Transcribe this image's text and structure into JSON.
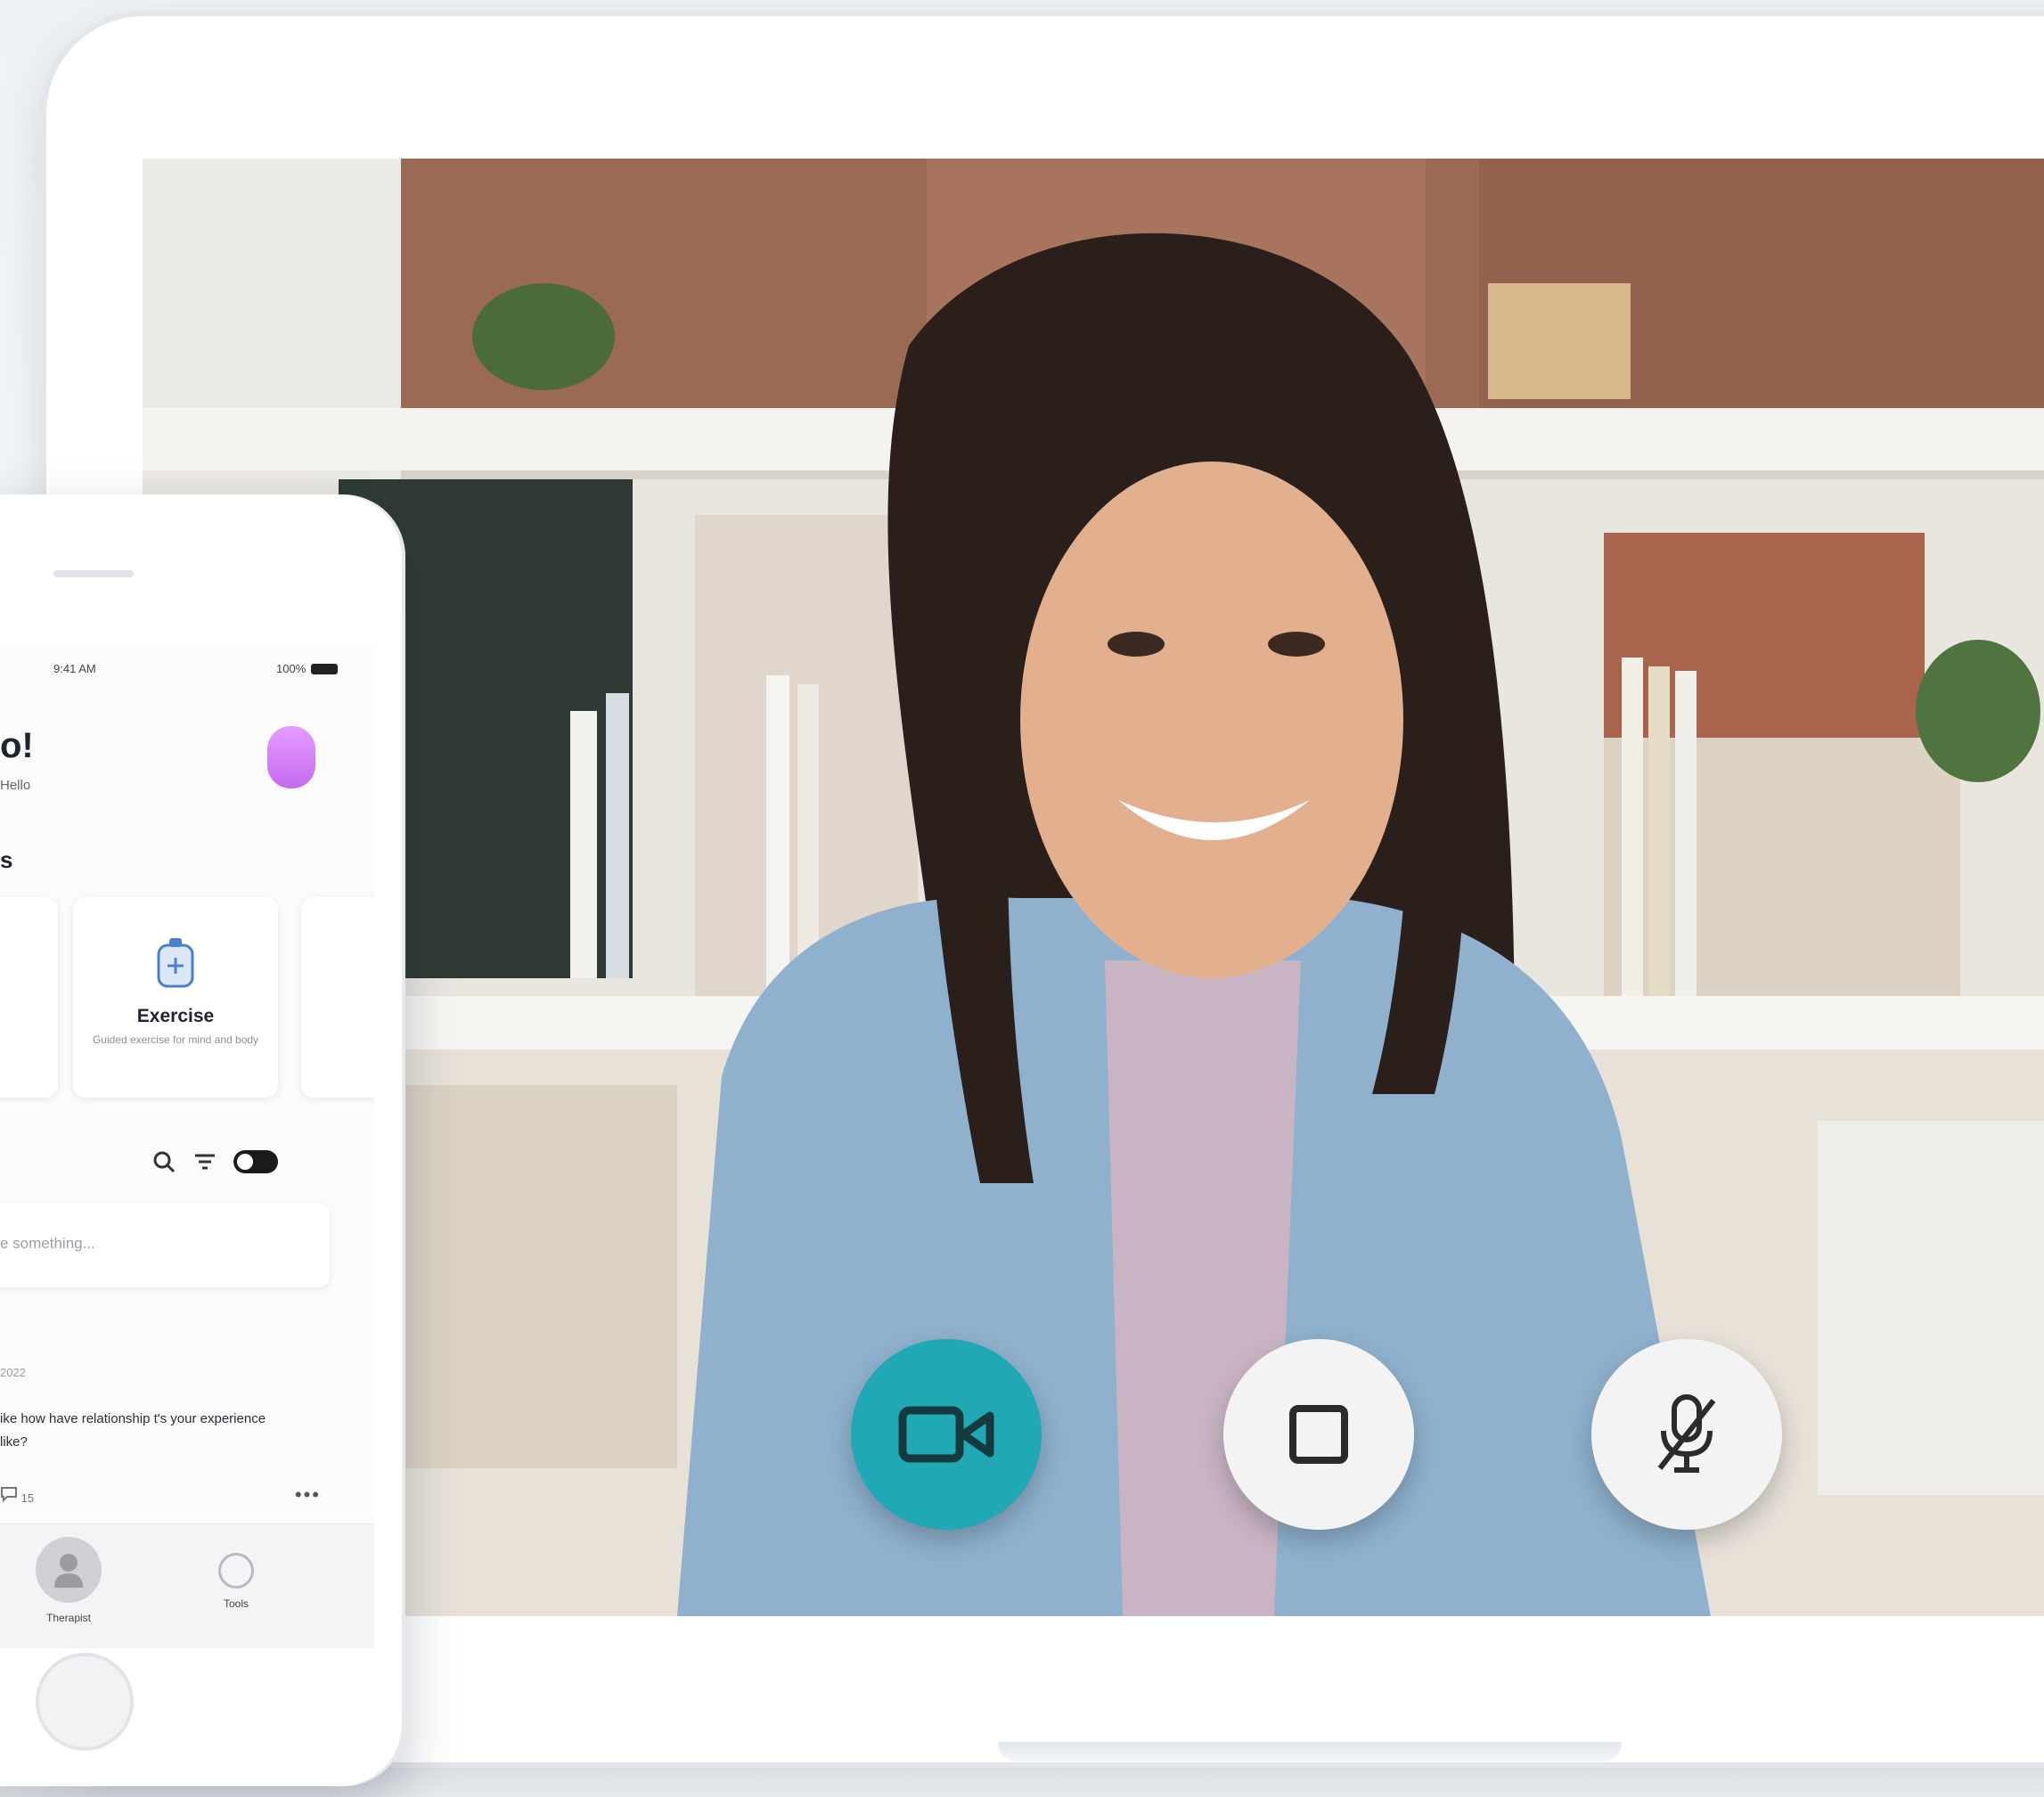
{
  "video_call": {
    "controls": {
      "camera_icon": "video-camera-icon",
      "stop_icon": "stop-square-icon",
      "mic_icon": "microphone-muted-icon"
    },
    "colors": {
      "camera_button": "#21a8b5",
      "control_button": "#f3f3f3"
    }
  },
  "phone": {
    "status": {
      "time": "9:41 AM",
      "battery": "100%"
    },
    "greeting": "o!",
    "greeting_sub": "Hello",
    "section_letter": "s",
    "cards": [
      {
        "title": "Exercise",
        "description": "Guided exercise for mind and body"
      }
    ],
    "compose_placeholder": "e something...",
    "post": {
      "meta": "2022",
      "text": "ike how have relationship t's your experience like?",
      "reply_count": "15"
    },
    "tabs": [
      {
        "label": "Therapist"
      },
      {
        "label": "Tools"
      }
    ]
  }
}
